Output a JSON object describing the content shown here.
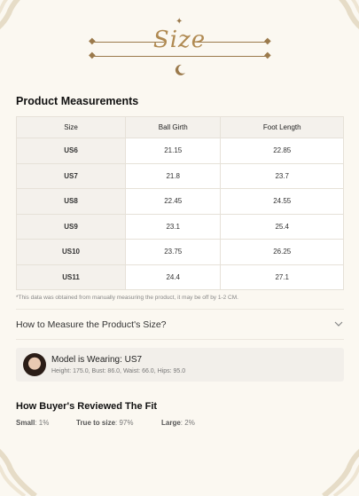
{
  "header": {
    "title": "Size"
  },
  "measurements": {
    "title": "Product Measurements",
    "columns": [
      "Size",
      "Ball Girth",
      "Foot Length"
    ],
    "rows": [
      [
        "US6",
        "21.15",
        "22.85"
      ],
      [
        "US7",
        "21.8",
        "23.7"
      ],
      [
        "US8",
        "22.45",
        "24.55"
      ],
      [
        "US9",
        "23.1",
        "25.4"
      ],
      [
        "US10",
        "23.75",
        "26.25"
      ],
      [
        "US11",
        "24.4",
        "27.1"
      ]
    ],
    "note": "*This data was obtained from manually measuring the product, it may be off by 1-2 CM."
  },
  "how_to_measure": {
    "label": "How to Measure the Product's Size?"
  },
  "model": {
    "wearing_label": "Model is Wearing: US7",
    "measurements": "Height: 175.0,  Bust: 86.0,  Waist: 66.0,  Hips: 95.0"
  },
  "reviews": {
    "title": "How Buyer's Reviewed The Fit",
    "small_label": "Small",
    "small_value": "1%",
    "true_label": "True to size",
    "true_value": "97%",
    "large_label": "Large",
    "large_value": "2%"
  },
  "colors": {
    "accent": "#b08a52",
    "background": "#fbf8f1",
    "ornament": "#9b7a4c"
  },
  "icons": {
    "moon": "crescent-moon-icon",
    "chevron": "chevron-down-icon"
  }
}
